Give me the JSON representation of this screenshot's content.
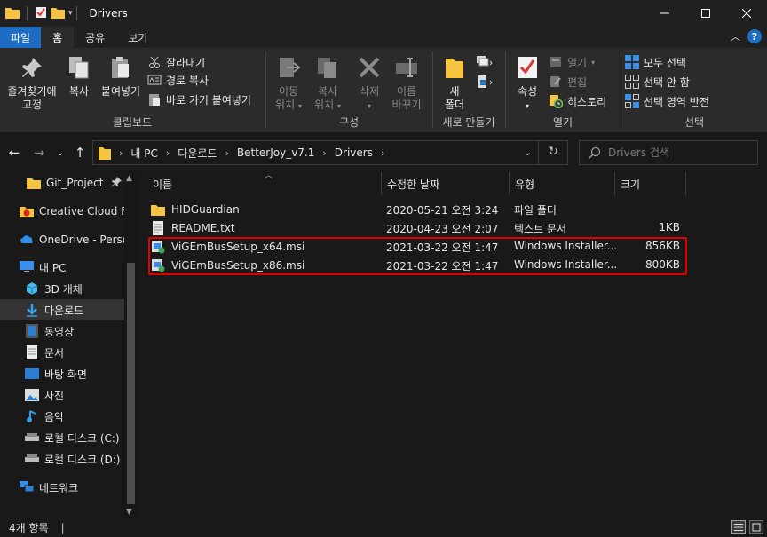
{
  "window": {
    "title": "Drivers"
  },
  "ribbon_tabs": [
    "파일",
    "홈",
    "공유",
    "보기"
  ],
  "ribbon": {
    "clipboard": {
      "pin_label": "즐겨찾기에\n고정",
      "copy_label": "복사",
      "paste_label": "붙여넣기",
      "cut_label": "잘라내기",
      "copy_path_label": "경로 복사",
      "paste_shortcut_label": "바로 가기 붙여넣기",
      "group_label": "클립보드"
    },
    "organize": {
      "move_label": "이동\n위치",
      "copy_to_label": "복사\n위치",
      "delete_label": "삭제",
      "rename_label": "이름\n바꾸기",
      "group_label": "구성"
    },
    "new": {
      "new_folder_label": "새\n폴더",
      "group_label": "새로 만들기"
    },
    "open": {
      "properties_label": "속성",
      "open_label": "열기",
      "edit_label": "편집",
      "history_label": "히스토리",
      "group_label": "열기"
    },
    "select": {
      "select_all_label": "모두 선택",
      "select_none_label": "선택 안 함",
      "invert_label": "선택 영역 반전",
      "group_label": "선택"
    }
  },
  "address": {
    "crumbs": [
      "내 PC",
      "다운로드",
      "BetterJoy_v7.1",
      "Drivers"
    ],
    "search_placeholder": "Drivers 검색"
  },
  "nav": [
    {
      "label": "Git_Project",
      "icon": "folder-icon",
      "pinned": true
    },
    {
      "label": "Creative Cloud Fil",
      "icon": "creative-cloud-icon"
    },
    {
      "label": "OneDrive - Persor",
      "icon": "onedrive-icon"
    },
    {
      "label": "내 PC",
      "icon": "pc-icon"
    },
    {
      "label": "3D 개체",
      "icon": "3d-objects-icon"
    },
    {
      "label": "다운로드",
      "icon": "download-icon",
      "selected": true
    },
    {
      "label": "동영상",
      "icon": "video-icon"
    },
    {
      "label": "문서",
      "icon": "document-icon"
    },
    {
      "label": "바탕 화면",
      "icon": "desktop-icon"
    },
    {
      "label": "사진",
      "icon": "pictures-icon"
    },
    {
      "label": "음악",
      "icon": "music-icon"
    },
    {
      "label": "로컬 디스크 (C:)",
      "icon": "drive-icon"
    },
    {
      "label": "로컬 디스크 (D:)",
      "icon": "drive-icon"
    },
    {
      "label": "네트워크",
      "icon": "network-icon"
    }
  ],
  "columns": [
    "이름",
    "수정한 날짜",
    "유형",
    "크기"
  ],
  "files": [
    {
      "name": "HIDGuardian",
      "date": "2020-05-21 오전 3:24",
      "type": "파일 폴더",
      "size": "",
      "icon": "folder-icon"
    },
    {
      "name": "README.txt",
      "date": "2020-04-23 오전 2:07",
      "type": "텍스트 문서",
      "size": "1KB",
      "icon": "text-file-icon"
    },
    {
      "name": "ViGEmBusSetup_x64.msi",
      "date": "2021-03-22 오전 1:47",
      "type": "Windows Installer...",
      "size": "856KB",
      "icon": "msi-icon"
    },
    {
      "name": "ViGEmBusSetup_x86.msi",
      "date": "2021-03-22 오전 1:47",
      "type": "Windows Installer...",
      "size": "800KB",
      "icon": "msi-icon"
    }
  ],
  "status": {
    "item_count": "4개 항목"
  },
  "colors": {
    "accent": "#1d6dc5",
    "highlight_border": "#e00000",
    "background": "#191919"
  }
}
